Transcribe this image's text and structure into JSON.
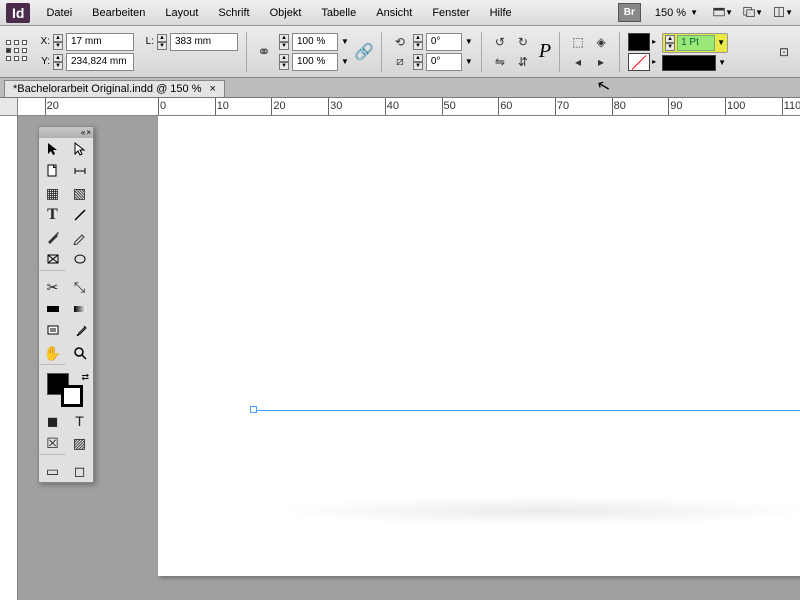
{
  "app": {
    "logo": "Id"
  },
  "menu": {
    "items": [
      "Datei",
      "Bearbeiten",
      "Layout",
      "Schrift",
      "Objekt",
      "Tabelle",
      "Ansicht",
      "Fenster",
      "Hilfe"
    ],
    "bridge": "Br",
    "zoom": "150 %"
  },
  "control": {
    "x_label": "X:",
    "x_value": "17 mm",
    "y_label": "Y:",
    "y_value": "234,824 mm",
    "l_label": "L:",
    "l_value": "383 mm",
    "scale_x": "100 %",
    "scale_y": "100 %",
    "rotate": "0°",
    "shear": "0°",
    "stroke_weight": "1 Pt"
  },
  "doc_tab": {
    "title": "*Bachelorarbeit Original.indd @ 150 %",
    "close": "×"
  },
  "ruler_h": [
    {
      "pos": -20,
      "label": "20"
    },
    {
      "pos": 0,
      "label": "0"
    },
    {
      "pos": 10,
      "label": "10"
    },
    {
      "pos": 20,
      "label": "20"
    },
    {
      "pos": 30,
      "label": "30"
    },
    {
      "pos": 40,
      "label": "40"
    },
    {
      "pos": 50,
      "label": "50"
    },
    {
      "pos": 60,
      "label": "60"
    },
    {
      "pos": 70,
      "label": "70"
    },
    {
      "pos": 80,
      "label": "80"
    },
    {
      "pos": 90,
      "label": "90"
    },
    {
      "pos": 100,
      "label": "100"
    },
    {
      "pos": 110,
      "label": "110"
    }
  ]
}
